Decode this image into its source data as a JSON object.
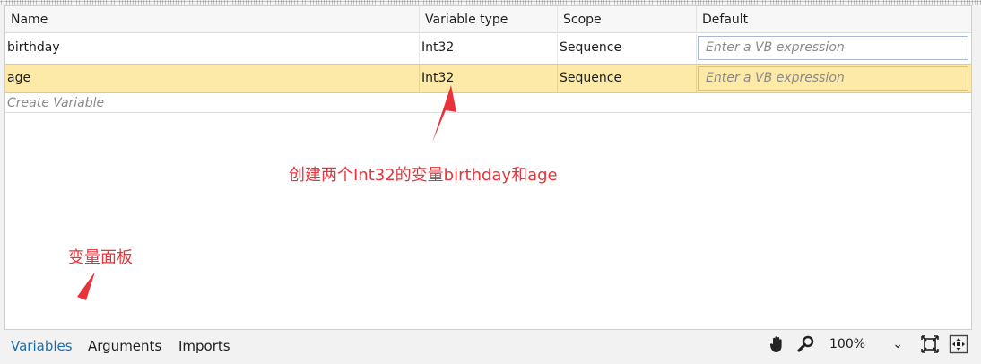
{
  "table": {
    "columns": [
      "Name",
      "Variable type",
      "Scope",
      "Default"
    ],
    "rows": [
      {
        "name": "birthday",
        "type": "Int32",
        "scope": "Sequence",
        "default_placeholder": "Enter a VB expression"
      },
      {
        "name": "age",
        "type": "Int32",
        "scope": "Sequence",
        "default_placeholder": "Enter a VB expression"
      }
    ],
    "create_label": "Create Variable"
  },
  "annotations": {
    "table_note": "创建两个Int32的变量birthday和age",
    "panel_note": "变量面板"
  },
  "bottom": {
    "tabs": [
      "Variables",
      "Arguments",
      "Imports"
    ],
    "zoom": "100%"
  },
  "colors": {
    "selected_row": "#fde9a8",
    "annotation": "#e8333b",
    "active_tab": "#1a6fb3"
  }
}
